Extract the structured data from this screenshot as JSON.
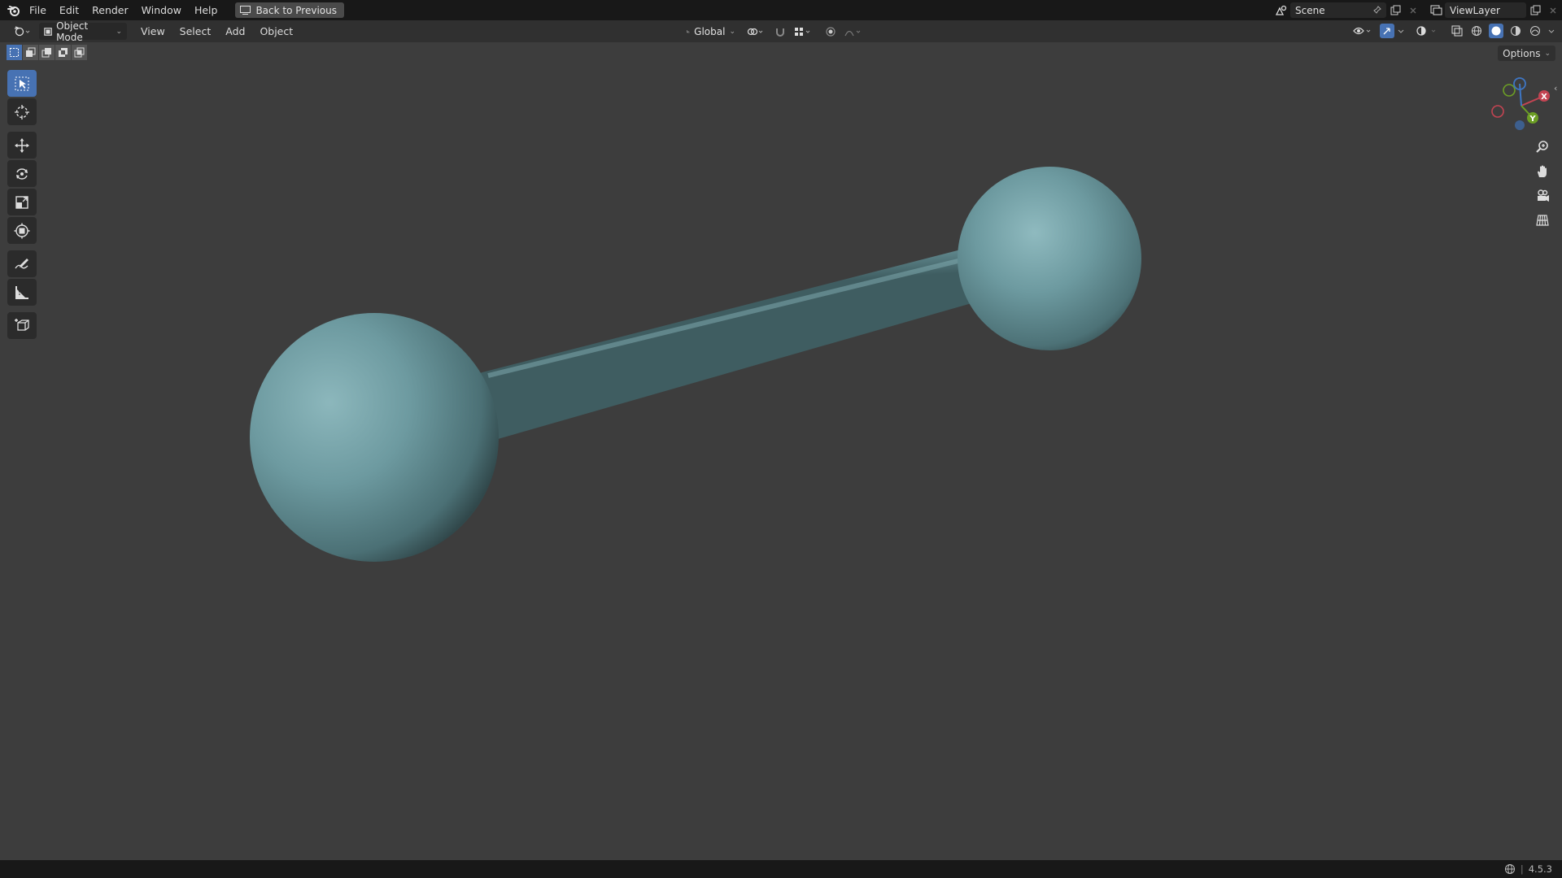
{
  "menubar": {
    "items": [
      "File",
      "Edit",
      "Render",
      "Window",
      "Help"
    ],
    "back_button": "Back to Previous",
    "scene_name": "Scene",
    "view_layer": "ViewLayer"
  },
  "header": {
    "mode": "Object Mode",
    "menus": [
      "View",
      "Select",
      "Add",
      "Object"
    ],
    "transform_orientation": "Global"
  },
  "viewport": {
    "options_label": "Options",
    "object_color": "#6d9aa0",
    "background_color": "#3d3d3d",
    "gizmo_axes": [
      "X",
      "Y"
    ]
  },
  "status": {
    "version": "4.5.3"
  }
}
